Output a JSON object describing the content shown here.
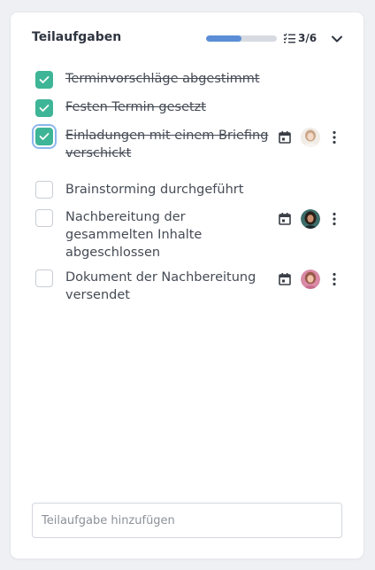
{
  "header": {
    "title": "Teilaufgaben",
    "progress_fraction": 0.5,
    "count_text": "3/6",
    "icons": {
      "checklist": "checklist-icon",
      "collapse": "chevron-down-icon"
    }
  },
  "subtasks": [
    {
      "label": "Terminvorschläge abgestimmt",
      "done": true
    },
    {
      "label": "Festen Termin gesetzt",
      "done": true
    },
    {
      "label": "Einladungen mit einem Briefing verschickt",
      "done": true,
      "focused": true,
      "has_date": true,
      "has_assignee": true
    },
    {
      "label": "Brainstorming durchgeführt",
      "done": false
    },
    {
      "label": "Nachbereitung der gesammelten Inhalte abgeschlossen",
      "done": false,
      "has_date": true,
      "has_assignee": true
    },
    {
      "label": "Dokument der Nachbereitung versendet",
      "done": false,
      "has_date": true,
      "has_assignee": true
    }
  ],
  "add_input": {
    "placeholder": "Teilaufgabe hinzufügen",
    "value": ""
  },
  "colors": {
    "checked": "#3eb596",
    "progress": "#5b8ed6",
    "focus_ring": "#8db6ec"
  }
}
